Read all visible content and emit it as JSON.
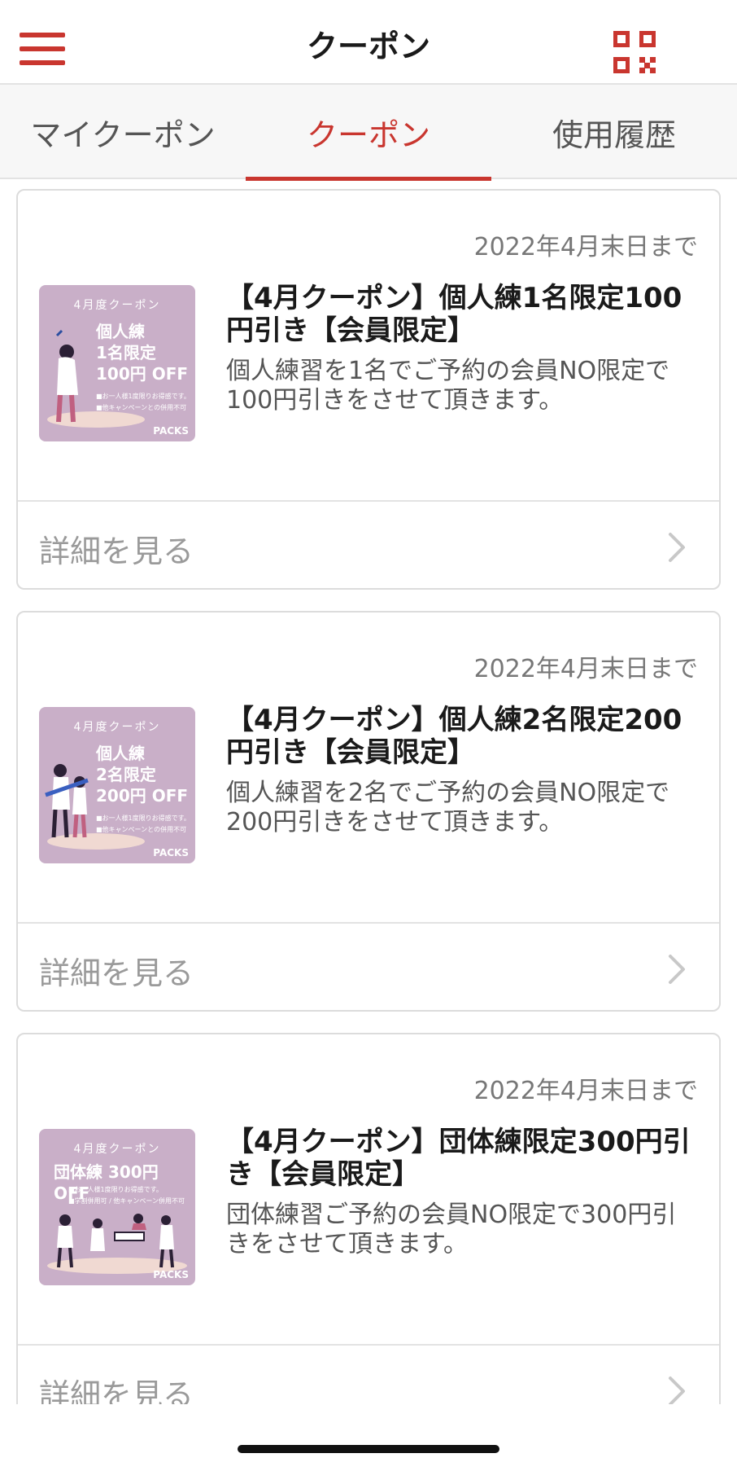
{
  "header": {
    "title": "クーポン",
    "menu_icon": "hamburger-menu-icon",
    "qr_icon": "qr-code-icon",
    "accent_color": "#c9362f"
  },
  "tabs": [
    {
      "label": "マイクーポン",
      "active": false
    },
    {
      "label": "クーポン",
      "active": true
    },
    {
      "label": "使用履歴",
      "active": false
    }
  ],
  "coupons": [
    {
      "expiry": "2022年4月末日まで",
      "title": "【4月クーポン】個人練1名限定100円引き【会員限定】",
      "description": "個人練習を1名でご予約の会員NO限定で100円引きをさせて頂きます。",
      "detail_label": "詳細を見る",
      "thumb": {
        "header": "4月度クーポン",
        "headline": "個人練\n1名限定\n100円 OFF",
        "notes": "■お一人様1度限りお得感です。\n■他キャンペーンとの併用不可",
        "brand": "PACKS"
      }
    },
    {
      "expiry": "2022年4月末日まで",
      "title": "【4月クーポン】個人練2名限定200円引き【会員限定】",
      "description": "個人練習を2名でご予約の会員NO限定で200円引きをさせて頂きます。",
      "detail_label": "詳細を見る",
      "thumb": {
        "header": "4月度クーポン",
        "headline": "個人練\n2名限定\n200円 OFF",
        "notes": "■お一人様1度限りお得感です。\n■他キャンペーンとの併用不可",
        "brand": "PACKS"
      }
    },
    {
      "expiry": "2022年4月末日まで",
      "title": "【4月クーポン】団体練限定300円引き【会員限定】",
      "description": "団体練習ご予約の会員NO限定で300円引きをさせて頂きます。",
      "detail_label": "詳細を見る",
      "thumb": {
        "header": "4月度クーポン",
        "headline": "団体練 300円 OFF",
        "notes": "■お一人様1度限りお得感です。\n■学割併用可 / 他キャンペーン併用不可",
        "brand": "PACKS"
      }
    }
  ]
}
